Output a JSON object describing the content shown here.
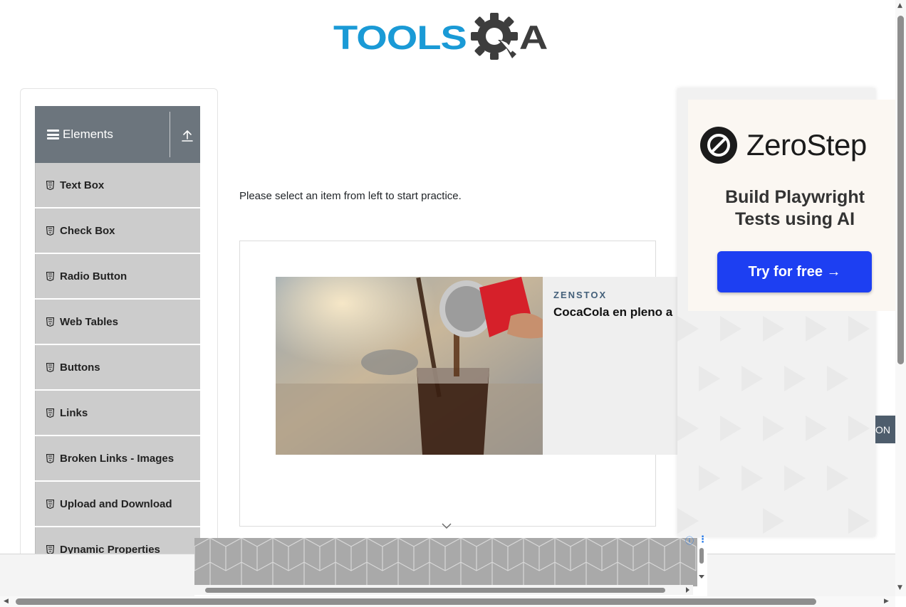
{
  "header": {
    "logo_left": "TOOLS",
    "logo_right": "A",
    "brand_color": "#1a9ad6"
  },
  "sidebar": {
    "group_title": "Elements",
    "group_icon": "hamburger-icon",
    "collapse_icon": "upload-arrow-icon",
    "items": [
      {
        "label": "Text Box",
        "icon": "html5-icon"
      },
      {
        "label": "Check Box",
        "icon": "html5-icon"
      },
      {
        "label": "Radio Button",
        "icon": "html5-icon"
      },
      {
        "label": "Web Tables",
        "icon": "html5-icon"
      },
      {
        "label": "Buttons",
        "icon": "html5-icon"
      },
      {
        "label": "Links",
        "icon": "html5-icon"
      },
      {
        "label": "Broken Links - Images",
        "icon": "html5-icon"
      },
      {
        "label": "Upload and Download",
        "icon": "html5-icon"
      },
      {
        "label": "Dynamic Properties",
        "icon": "html5-icon"
      }
    ]
  },
  "main": {
    "prompt": "Please select an item from left to start practice."
  },
  "center_ad": {
    "brand": "ZENSTOX",
    "headline": "CocaCola en pleno a"
  },
  "right_ad": {
    "name": "ZeroStep",
    "tagline_line1": "Build Playwright",
    "tagline_line2": "Tests using AI",
    "cta": "Try for free →",
    "cta_color": "#1d3ff2"
  },
  "peek_button": {
    "text": "ON"
  },
  "bottom_ad": {
    "info_icon": "ⓘ",
    "more_icon": "⋮"
  }
}
